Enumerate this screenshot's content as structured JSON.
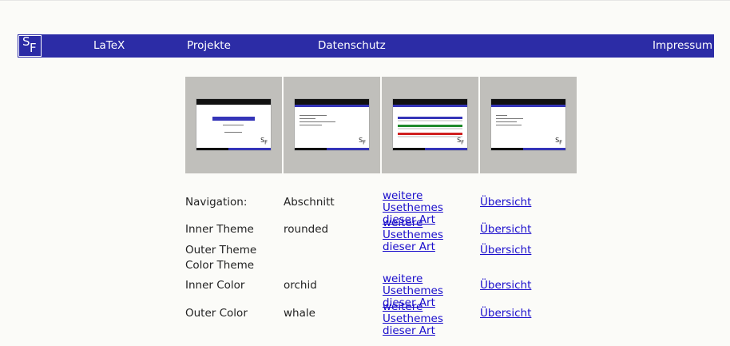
{
  "nav": {
    "logo_s": "S",
    "logo_f": "F",
    "items": [
      "LaTeX",
      "Projekte",
      "Datenschutz",
      "Impressum"
    ]
  },
  "thumbnails": [
    {
      "name": "title-slide"
    },
    {
      "name": "content-slide"
    },
    {
      "name": "blocks-slide"
    },
    {
      "name": "references-slide"
    }
  ],
  "rows": [
    {
      "label": "Navigation:",
      "value": "Abschnitt",
      "more": "weitere Usethemes dieser Art",
      "overview": "Übersicht"
    },
    {
      "label": "Inner Theme",
      "value": "rounded",
      "more": "weitere Usethemes dieser Art",
      "overview": "Übersicht"
    },
    {
      "label": "Outer Theme",
      "value": "",
      "more": "",
      "overview": "Übersicht"
    },
    {
      "label": "Color Theme",
      "value": "",
      "more": "",
      "overview": ""
    },
    {
      "label": "Inner Color",
      "value": "orchid",
      "more": "weitere Usethemes dieser Art",
      "overview": "Übersicht"
    },
    {
      "label": "Outer Color",
      "value": "whale",
      "more": "weitere Usethemes dieser Art",
      "overview": "Übersicht"
    }
  ],
  "colors": {
    "navbar": "#2c2ca6",
    "link": "#1a0dcc",
    "thumb_bg": "#c0bfbb"
  }
}
